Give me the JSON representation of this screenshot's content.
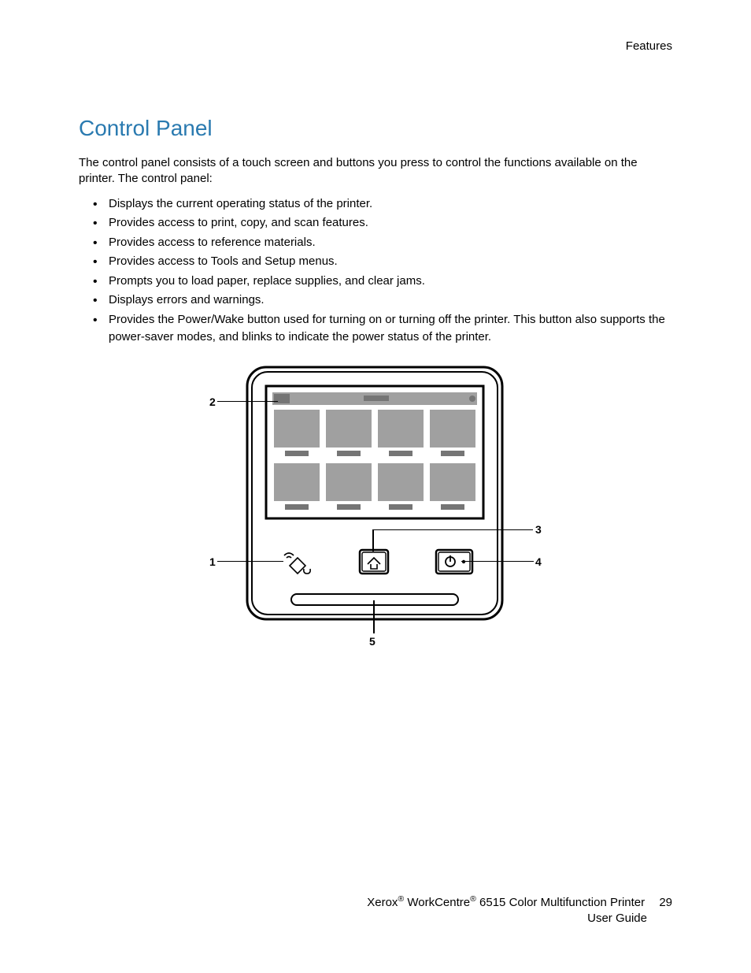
{
  "header": {
    "section": "Features"
  },
  "heading": "Control Panel",
  "intro": "The control panel consists of a touch screen and buttons you press to control the functions available on the printer. The control panel:",
  "bullets": [
    "Displays the current operating status of the printer.",
    "Provides access to print, copy, and scan features.",
    "Provides access to reference materials.",
    "Provides access to Tools and Setup menus.",
    "Prompts you to load paper, replace supplies, and clear jams.",
    "Displays errors and warnings.",
    "Provides the Power/Wake button used for turning on or turning off the printer. This button also supports the power-saver modes, and blinks to indicate the power status of the printer."
  ],
  "callouts": {
    "c1": "1",
    "c2": "2",
    "c3": "3",
    "c4": "4",
    "c5": "5"
  },
  "footer": {
    "line1_pre": "Xerox",
    "line1_mid": " WorkCentre",
    "line1_post": " 6515 Color Multifunction Printer",
    "line2": "User Guide",
    "pagenum": "29",
    "reg": "®"
  }
}
